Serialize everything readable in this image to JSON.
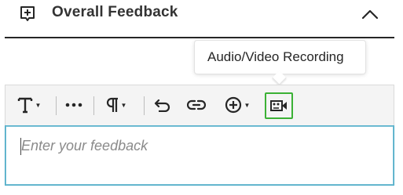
{
  "header": {
    "title": "Overall Feedback"
  },
  "tooltip": {
    "text": "Audio/Video Recording"
  },
  "toolbar": {
    "buttons": [
      {
        "name": "text-format",
        "icon": "text-format-icon",
        "has_dropdown": true
      },
      {
        "name": "more",
        "icon": "more-icon",
        "has_dropdown": false
      },
      {
        "name": "paragraph",
        "icon": "paragraph-icon",
        "has_dropdown": true
      },
      {
        "name": "undo",
        "icon": "undo-icon",
        "has_dropdown": false
      },
      {
        "name": "link",
        "icon": "link-icon",
        "has_dropdown": false
      },
      {
        "name": "insert",
        "icon": "plus-circle-icon",
        "has_dropdown": true
      },
      {
        "name": "audio-video-recording",
        "icon": "video-record-icon",
        "has_dropdown": false,
        "highlighted": true
      }
    ]
  },
  "editor": {
    "placeholder": "Enter your feedback"
  },
  "colors": {
    "highlight_border": "#3bb135",
    "focus_border": "#48a9c5",
    "toolbar_bg": "#f4f4f4"
  }
}
